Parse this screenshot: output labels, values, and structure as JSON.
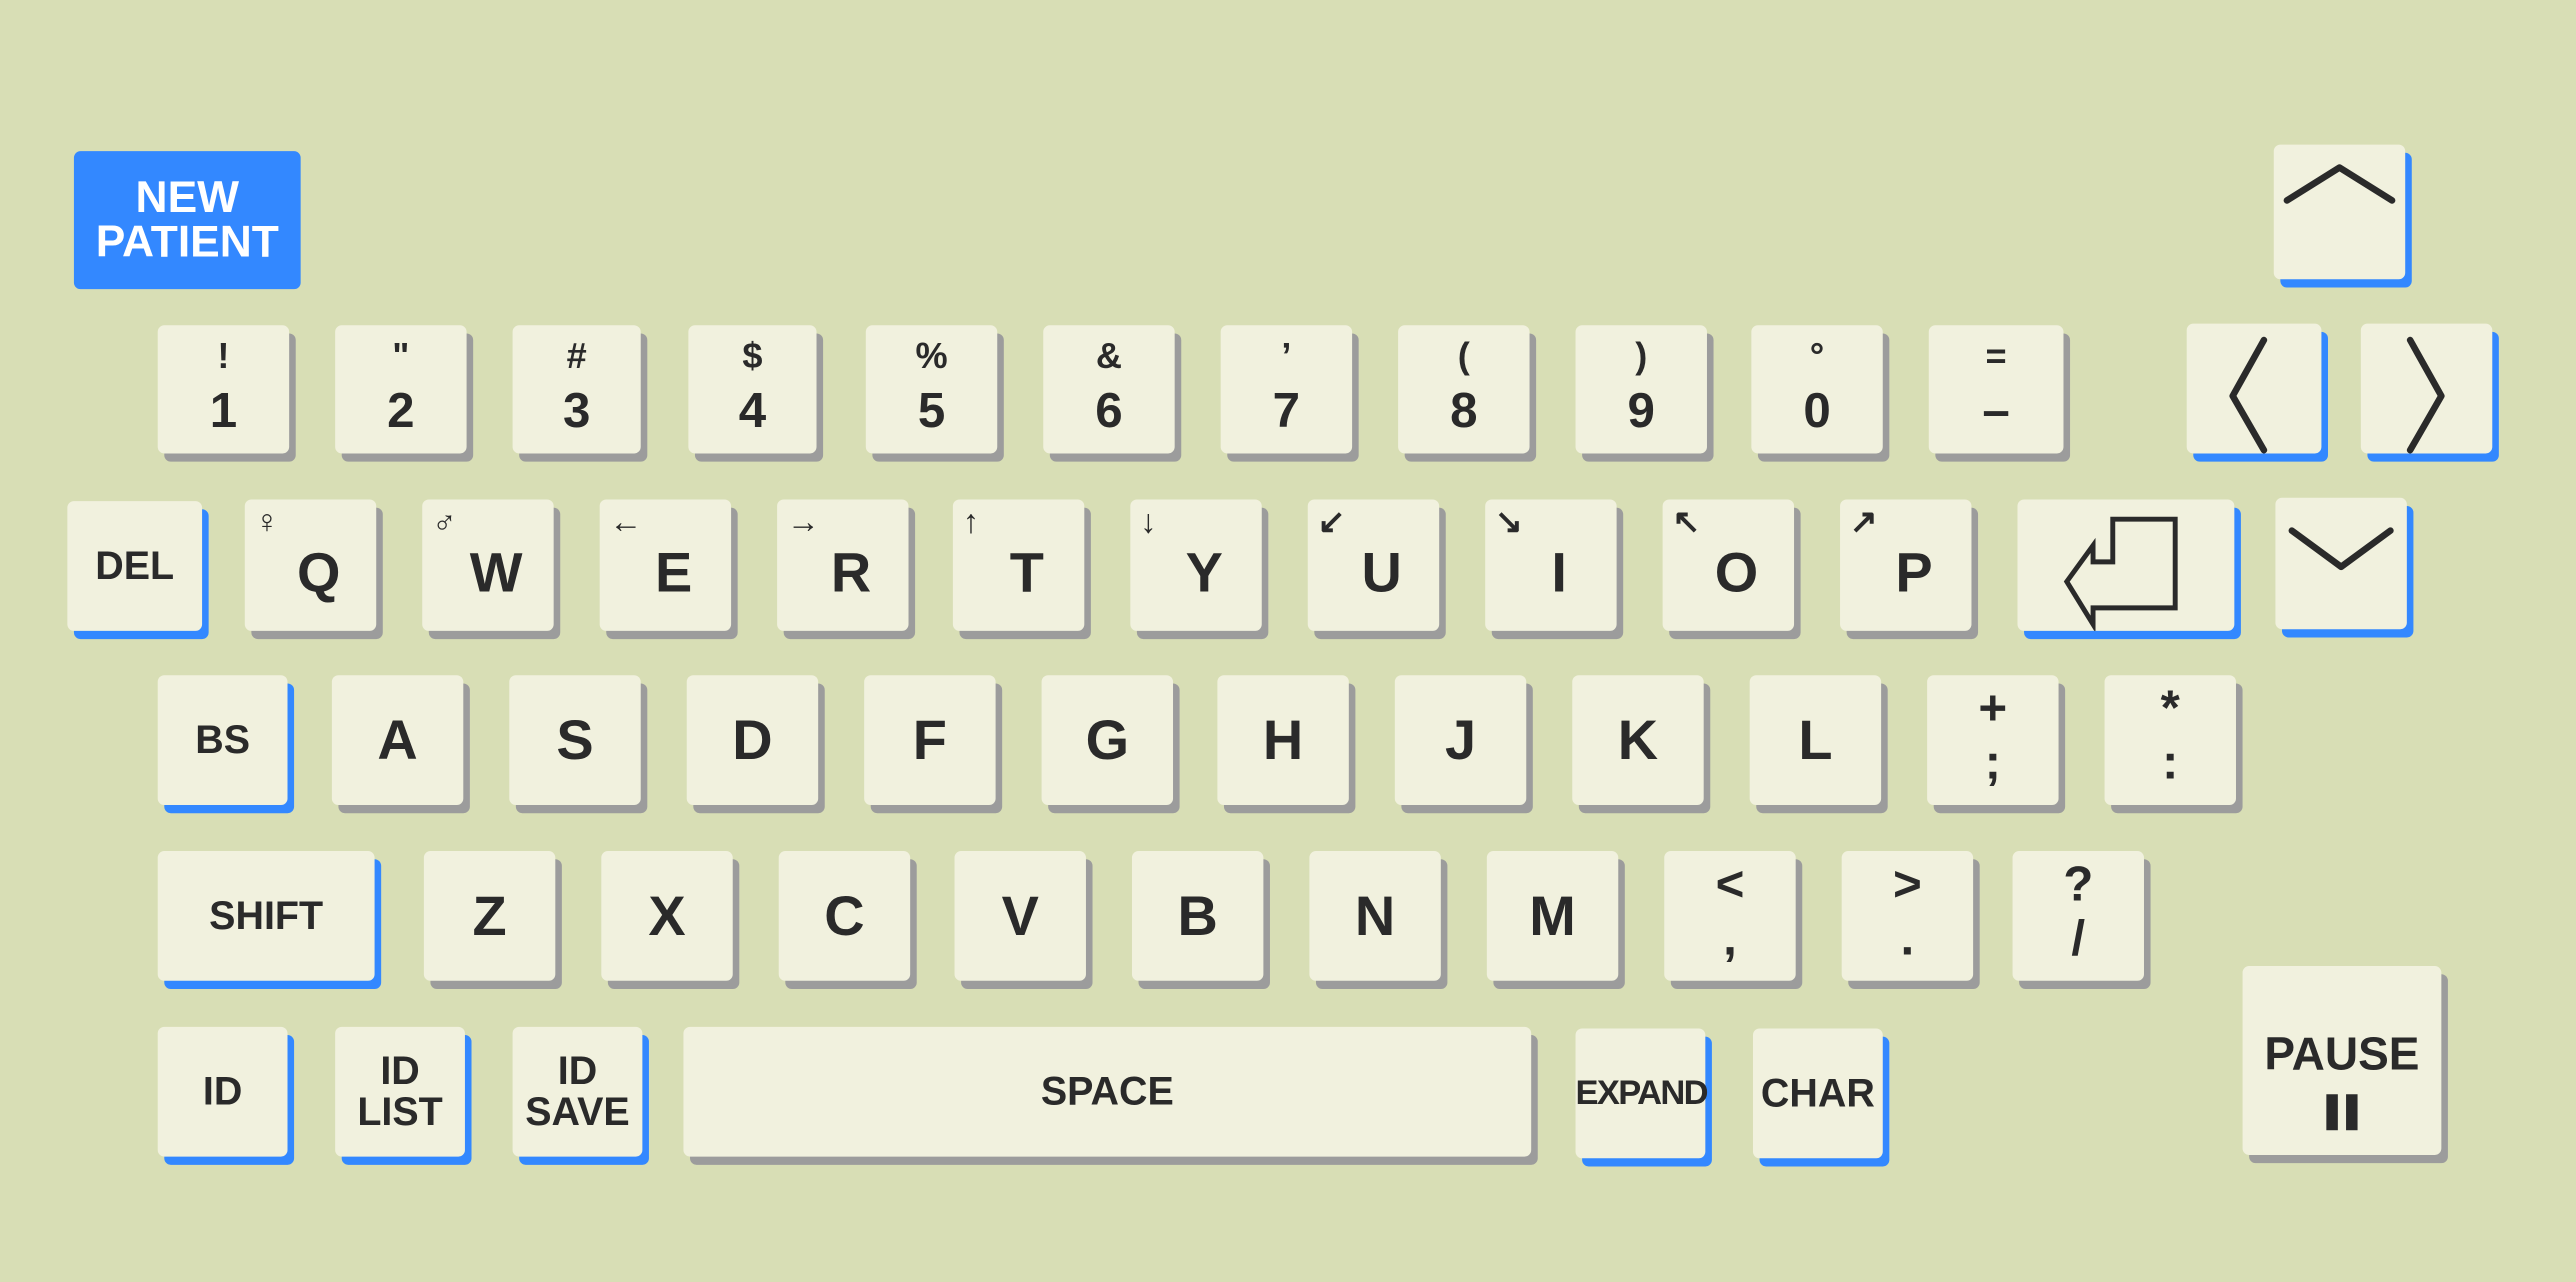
{
  "colors": {
    "background": "#d8deb5",
    "key_face": "#f1f1de",
    "key_shadow_gray": "#9c9c9c",
    "accent_blue": "#3388ff",
    "text": "#2a2a2a"
  },
  "keys": [
    {
      "name": "new-patient-button",
      "label": "NEW\nPATIENT",
      "style": "solid"
    },
    {
      "name": "arrow-up-key",
      "icon": "chevron-up-icon",
      "style": "blue"
    },
    {
      "name": "key-1",
      "label": "1",
      "shift": "!",
      "style": "gray"
    },
    {
      "name": "key-2",
      "label": "2",
      "shift": "\"",
      "style": "gray"
    },
    {
      "name": "key-3",
      "label": "3",
      "shift": "#",
      "style": "gray"
    },
    {
      "name": "key-4",
      "label": "4",
      "shift": "$",
      "style": "gray"
    },
    {
      "name": "key-5",
      "label": "5",
      "shift": "%",
      "style": "gray"
    },
    {
      "name": "key-6",
      "label": "6",
      "shift": "&",
      "style": "gray"
    },
    {
      "name": "key-7",
      "label": "7",
      "shift": "’",
      "style": "gray"
    },
    {
      "name": "key-8",
      "label": "8",
      "shift": "(",
      "style": "gray"
    },
    {
      "name": "key-9",
      "label": "9",
      "shift": ")",
      "style": "gray"
    },
    {
      "name": "key-0",
      "label": "0",
      "shift": "°",
      "style": "gray"
    },
    {
      "name": "key-minus",
      "label": "–",
      "shift": "=",
      "style": "gray"
    },
    {
      "name": "arrow-left-key",
      "icon": "chevron-left-icon",
      "style": "blue"
    },
    {
      "name": "arrow-right-key",
      "icon": "chevron-right-icon",
      "style": "blue"
    },
    {
      "name": "del-key",
      "label": "DEL",
      "style": "blue"
    },
    {
      "name": "key-q",
      "label": "Q",
      "shift": "♀",
      "style": "gray"
    },
    {
      "name": "key-w",
      "label": "W",
      "shift": "♂",
      "style": "gray"
    },
    {
      "name": "key-e",
      "label": "E",
      "shift": "←",
      "style": "gray"
    },
    {
      "name": "key-r",
      "label": "R",
      "shift": "→",
      "style": "gray"
    },
    {
      "name": "key-t",
      "label": "T",
      "shift": "↑",
      "style": "gray"
    },
    {
      "name": "key-y",
      "label": "Y",
      "shift": "↓",
      "style": "gray"
    },
    {
      "name": "key-u",
      "label": "U",
      "shift": "↙",
      "style": "gray"
    },
    {
      "name": "key-i",
      "label": "I",
      "shift": "↘",
      "style": "gray"
    },
    {
      "name": "key-o",
      "label": "O",
      "shift": "↖",
      "style": "gray"
    },
    {
      "name": "key-p",
      "label": "P",
      "shift": "↗",
      "style": "gray"
    },
    {
      "name": "enter-key",
      "icon": "enter-icon",
      "style": "blue"
    },
    {
      "name": "arrow-down-key",
      "icon": "chevron-down-icon",
      "style": "blue"
    },
    {
      "name": "bs-key",
      "label": "BS",
      "style": "blue"
    },
    {
      "name": "key-a",
      "label": "A",
      "style": "gray"
    },
    {
      "name": "key-s",
      "label": "S",
      "style": "gray"
    },
    {
      "name": "key-d",
      "label": "D",
      "style": "gray"
    },
    {
      "name": "key-f",
      "label": "F",
      "style": "gray"
    },
    {
      "name": "key-g",
      "label": "G",
      "style": "gray"
    },
    {
      "name": "key-h",
      "label": "H",
      "style": "gray"
    },
    {
      "name": "key-j",
      "label": "J",
      "style": "gray"
    },
    {
      "name": "key-k",
      "label": "K",
      "style": "gray"
    },
    {
      "name": "key-l",
      "label": "L",
      "style": "gray"
    },
    {
      "name": "key-semicolon",
      "label": ";",
      "shift": "+",
      "style": "gray"
    },
    {
      "name": "key-colon",
      "label": ":",
      "shift": "*",
      "style": "gray"
    },
    {
      "name": "shift-key",
      "label": "SHIFT",
      "style": "blue"
    },
    {
      "name": "key-z",
      "label": "Z",
      "style": "gray"
    },
    {
      "name": "key-x",
      "label": "X",
      "style": "gray"
    },
    {
      "name": "key-c",
      "label": "C",
      "style": "gray"
    },
    {
      "name": "key-v",
      "label": "V",
      "style": "gray"
    },
    {
      "name": "key-b",
      "label": "B",
      "style": "gray"
    },
    {
      "name": "key-n",
      "label": "N",
      "style": "gray"
    },
    {
      "name": "key-m",
      "label": "M",
      "style": "gray"
    },
    {
      "name": "key-comma",
      "label": ",",
      "shift": "<",
      "style": "gray"
    },
    {
      "name": "key-period",
      "label": ".",
      "shift": ">",
      "style": "gray"
    },
    {
      "name": "key-slash",
      "label": "/",
      "shift": "?",
      "style": "gray"
    },
    {
      "name": "pause-key",
      "label": "PAUSE",
      "icon": "pause-icon",
      "style": "gray"
    },
    {
      "name": "id-key",
      "label": "ID",
      "style": "blue"
    },
    {
      "name": "id-list-key",
      "label": "ID\nLIST",
      "style": "blue"
    },
    {
      "name": "id-save-key",
      "label": "ID\nSAVE",
      "style": "blue"
    },
    {
      "name": "space-key",
      "label": "SPACE",
      "style": "gray"
    },
    {
      "name": "expand-key",
      "label": "EXPAND",
      "style": "blue"
    },
    {
      "name": "char-key",
      "label": "CHAR",
      "style": "blue"
    }
  ]
}
